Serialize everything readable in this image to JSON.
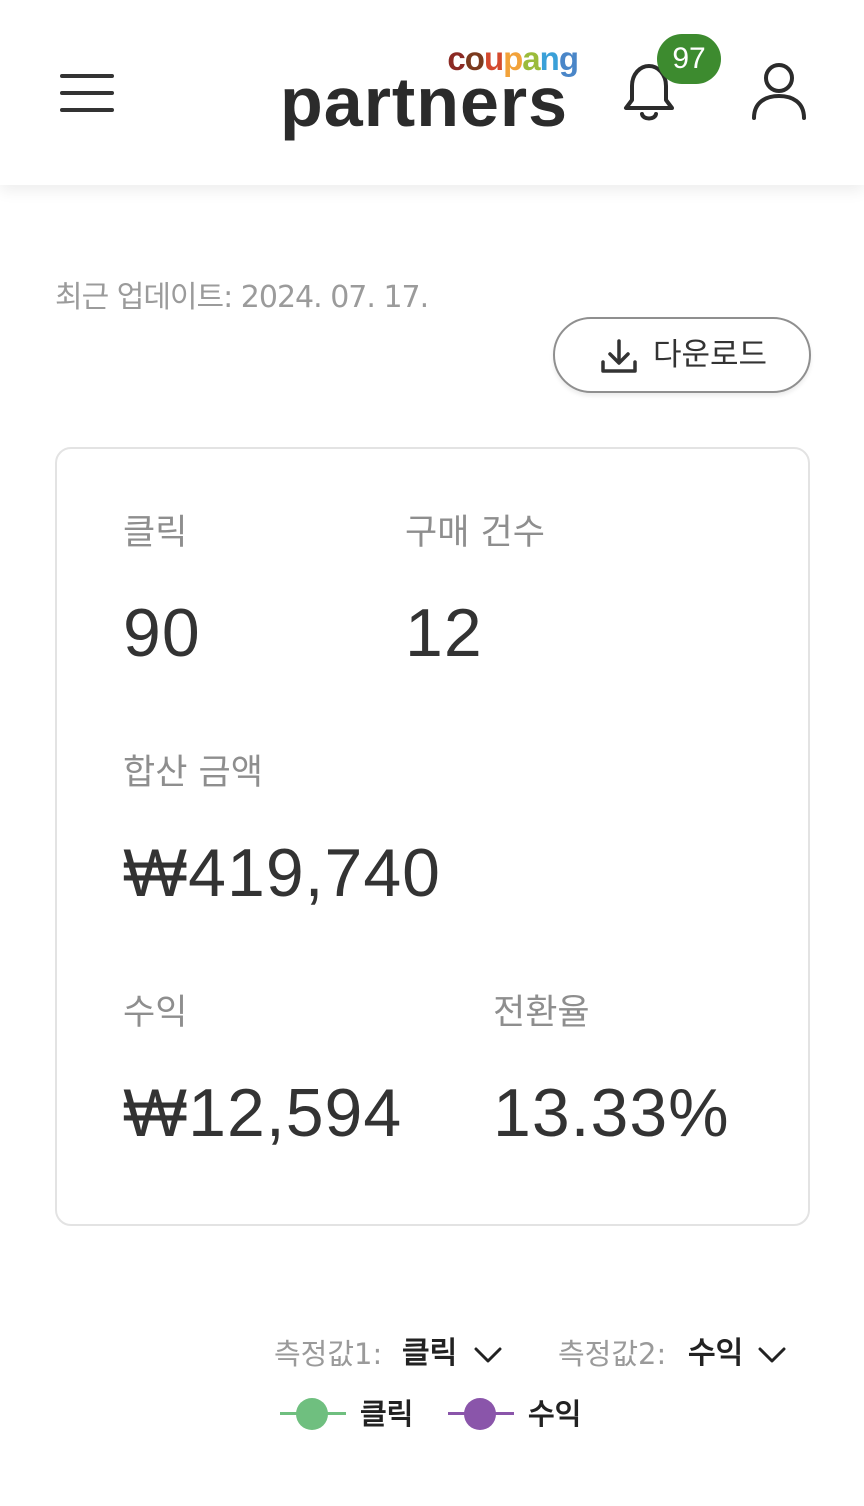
{
  "header": {
    "logo_top": "coupang",
    "logo_main": "partners",
    "notification_count": "97",
    "brand_colors": {
      "c": "#8b2a24",
      "o": "#7a3a1e",
      "u": "#d4492e",
      "p": "#f2a23a",
      "a": "#9bbb3a",
      "n": "#3aa0d8",
      "g": "#4a86c8"
    },
    "icons": [
      "menu-icon",
      "bell-icon",
      "user-icon"
    ],
    "badge_color": "#3d8b2f"
  },
  "update": {
    "text": "최근 업데이트: 2024. 07. 17."
  },
  "download": {
    "label": "다운로드",
    "icon": "download-icon"
  },
  "stats": {
    "clicks_label": "클릭",
    "clicks_value": "90",
    "purchases_label": "구매 건수",
    "purchases_value": "12",
    "total_amount_label": "합산 금액",
    "total_amount_value": "₩419,740",
    "revenue_label": "수익",
    "revenue_value": "₩12,594",
    "conversion_label": "전환율",
    "conversion_value": "13.33%"
  },
  "chart_controls": {
    "metric1_label": "측정값1:",
    "metric1_value": "클릭",
    "metric2_label": "측정값2:",
    "metric2_value": "수익",
    "legend": [
      {
        "label": "클릭",
        "color": "#6fbf7f"
      },
      {
        "label": "수익",
        "color": "#8a55aa"
      }
    ]
  }
}
